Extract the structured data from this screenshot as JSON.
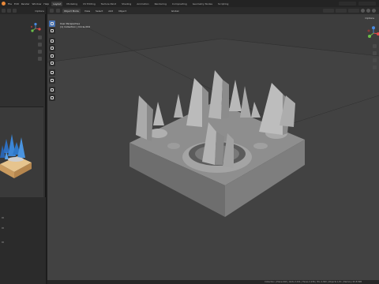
{
  "topbar": {
    "menu": [
      "File",
      "Edit",
      "Render",
      "Window",
      "Help"
    ],
    "workspaces": [
      "Layout",
      "Modeling",
      "UV Editing",
      "Texture Paint",
      "Shading",
      "Animation",
      "Rendering",
      "Compositing",
      "Geometry Nodes",
      "Scripting"
    ],
    "active_workspace_index": 0
  },
  "left_panel": {
    "options_label": "Options"
  },
  "viewport": {
    "mode": "Object Mode",
    "menus": [
      "View",
      "Select",
      "Add",
      "Object"
    ],
    "transform_orientation": "Global",
    "view_title": "User Perspective",
    "collection_info": "(1) Collection | Circle.004",
    "options_label": "Options"
  },
  "statusbar": {
    "text": "Collection | Plane.004 | Verts 2,011 | Faces 2,236 | Tris 4,300 | Objects 1/21 | Memory 63.8 MiB"
  },
  "colors": {
    "accent": "#4772b3",
    "viewport_bg": "#3d3d3d",
    "model_gray": "#9a9a9a",
    "crystal_blue": "#3c86d6",
    "wood": "#d9b27a"
  },
  "icons": [
    "blender-logo-icon",
    "select-box-icon",
    "cursor-icon",
    "move-icon",
    "rotate-icon",
    "scale-icon",
    "transform-icon",
    "annotate-icon",
    "measure-icon",
    "add-cube-icon",
    "axis-gizmo-icon",
    "zoom-icon",
    "pan-icon",
    "camera-icon"
  ]
}
